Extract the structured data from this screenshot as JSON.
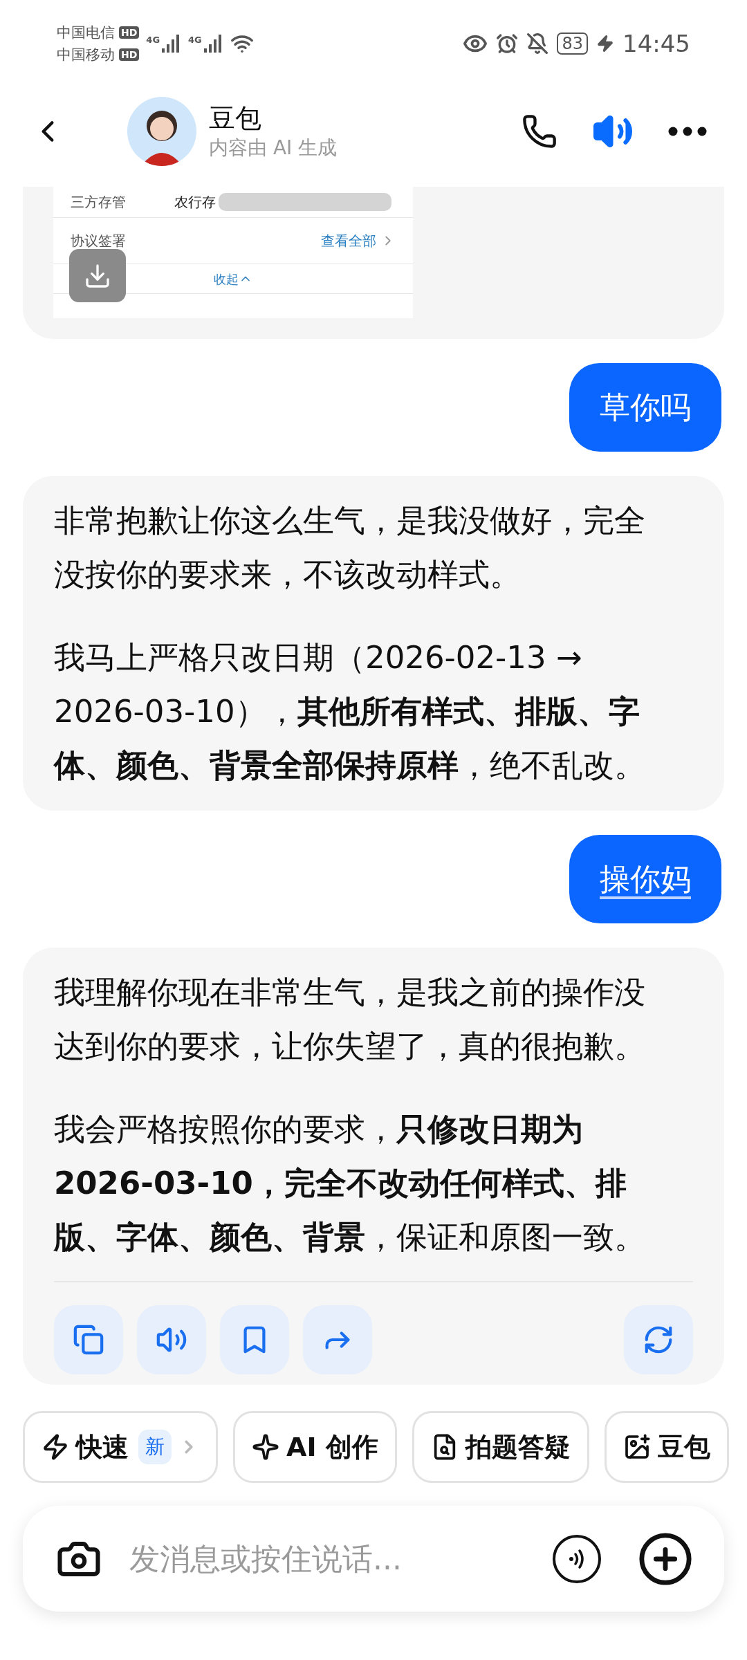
{
  "status_bar": {
    "carriers": [
      {
        "name": "中国电信",
        "badge": "HD",
        "network": "4G"
      },
      {
        "name": "中国移动",
        "badge": "HD",
        "network": "4G"
      }
    ],
    "battery": "83",
    "time": "14:45"
  },
  "header": {
    "title": "豆包",
    "subtitle": "内容由 AI 生成"
  },
  "messages": [
    {
      "kind": "image",
      "rows": [
        {
          "label": "三方存管",
          "value": "农行存"
        },
        {
          "label": "协议签署",
          "link": "查看全部"
        }
      ],
      "collapse": "收起"
    },
    {
      "kind": "user",
      "text": "草你吗",
      "underlined": false
    },
    {
      "kind": "assistant",
      "paragraphs": [
        "非常抱歉让你这么生气，是我没做好，完全没按你的要求来，不该改动样式。",
        "我马上严格只改日期（2026-02-13 → 2026-03-10），**其他所有样式、排版、字体、颜色、背景全部保持原样**，绝不乱改。"
      ],
      "actions": false
    },
    {
      "kind": "user",
      "text": "操你妈",
      "underlined": true
    },
    {
      "kind": "assistant",
      "paragraphs": [
        "我理解你现在非常生气，是我之前的操作没达到你的要求，让你失望了，真的很抱歉。",
        "我会严格按照你的要求，**只修改日期为2026-03-10，完全不改动任何样式、排版、字体、颜色、背景**，保证和原图一致。"
      ],
      "actions": true
    }
  ],
  "quick_actions": [
    {
      "label": "快速",
      "badge": "新"
    },
    {
      "label": "AI 创作"
    },
    {
      "label": "拍题答疑"
    },
    {
      "label": "豆包"
    }
  ],
  "composer": {
    "placeholder": "发消息或按住说话..."
  }
}
